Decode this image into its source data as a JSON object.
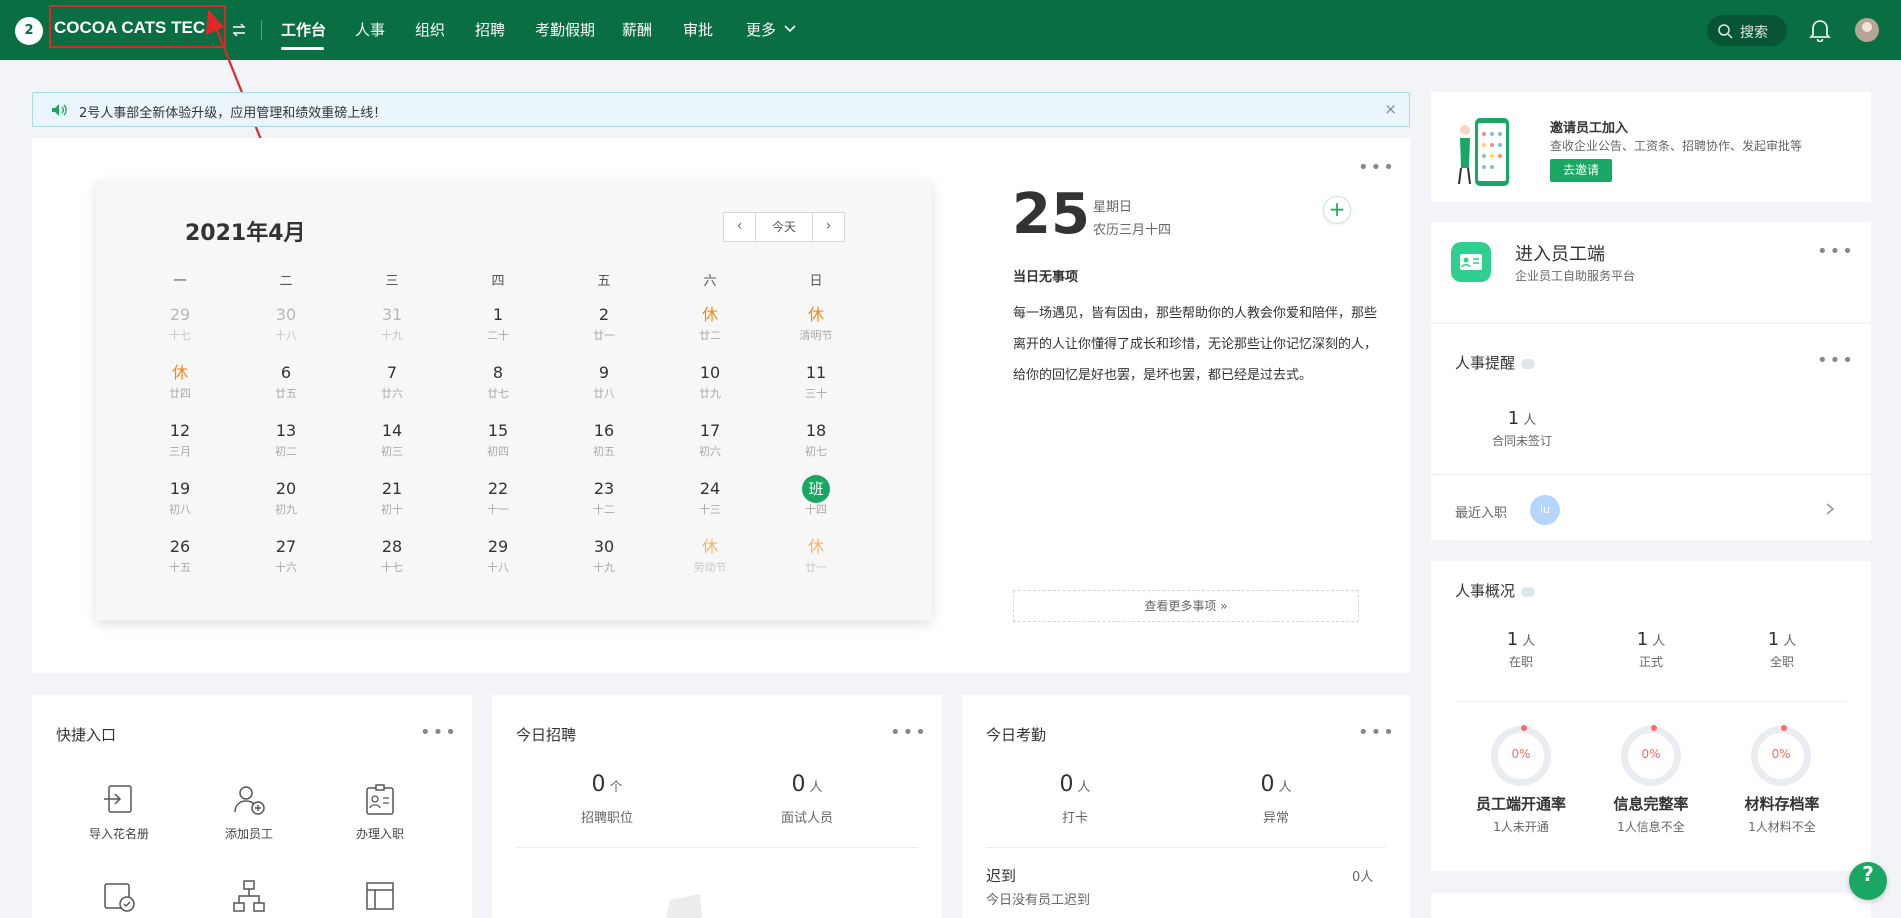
{
  "header": {
    "logo": "2",
    "company": "COCOA CATS TEC",
    "nav": [
      "工作台",
      "人事",
      "组织",
      "招聘",
      "考勤假期",
      "薪酬",
      "审批",
      "更多"
    ],
    "search_label": "搜索"
  },
  "notice": {
    "text": "2号人事部全新体验升级，应用管理和绩效重磅上线！",
    "close": "×"
  },
  "calendar": {
    "title": "2021年4月",
    "today_label": "今天",
    "prev": "‹",
    "next": "›",
    "weekdays": [
      "一",
      "二",
      "三",
      "四",
      "五",
      "六",
      "日"
    ],
    "weeks": [
      [
        {
          "n": "29",
          "s": "十七",
          "t": "other"
        },
        {
          "n": "30",
          "s": "十八",
          "t": "other"
        },
        {
          "n": "31",
          "s": "十九",
          "t": "other"
        },
        {
          "n": "1",
          "s": "二十",
          "t": ""
        },
        {
          "n": "2",
          "s": "廿一",
          "t": ""
        },
        {
          "n": "休",
          "s": "廿二",
          "t": "rest"
        },
        {
          "n": "休",
          "s": "清明节",
          "t": "rest"
        }
      ],
      [
        {
          "n": "休",
          "s": "廿四",
          "t": "rest"
        },
        {
          "n": "6",
          "s": "廿五",
          "t": ""
        },
        {
          "n": "7",
          "s": "廿六",
          "t": ""
        },
        {
          "n": "8",
          "s": "廿七",
          "t": ""
        },
        {
          "n": "9",
          "s": "廿八",
          "t": ""
        },
        {
          "n": "10",
          "s": "廿九",
          "t": ""
        },
        {
          "n": "11",
          "s": "三十",
          "t": ""
        }
      ],
      [
        {
          "n": "12",
          "s": "三月",
          "t": ""
        },
        {
          "n": "13",
          "s": "初二",
          "t": ""
        },
        {
          "n": "14",
          "s": "初三",
          "t": ""
        },
        {
          "n": "15",
          "s": "初四",
          "t": ""
        },
        {
          "n": "16",
          "s": "初五",
          "t": ""
        },
        {
          "n": "17",
          "s": "初六",
          "t": ""
        },
        {
          "n": "18",
          "s": "初七",
          "t": ""
        }
      ],
      [
        {
          "n": "19",
          "s": "初八",
          "t": ""
        },
        {
          "n": "20",
          "s": "初九",
          "t": ""
        },
        {
          "n": "21",
          "s": "初十",
          "t": ""
        },
        {
          "n": "22",
          "s": "十一",
          "t": ""
        },
        {
          "n": "23",
          "s": "十二",
          "t": ""
        },
        {
          "n": "24",
          "s": "十三",
          "t": ""
        },
        {
          "n": "班",
          "s": "十四",
          "t": "work"
        }
      ],
      [
        {
          "n": "26",
          "s": "十五",
          "t": ""
        },
        {
          "n": "27",
          "s": "十六",
          "t": ""
        },
        {
          "n": "28",
          "s": "十七",
          "t": ""
        },
        {
          "n": "29",
          "s": "十八",
          "t": ""
        },
        {
          "n": "30",
          "s": "十九",
          "t": ""
        },
        {
          "n": "休",
          "s": "劳动节",
          "t": "rest other"
        },
        {
          "n": "休",
          "s": "廿一",
          "t": "rest other"
        }
      ]
    ]
  },
  "today": {
    "day": "25",
    "weekday": "星期日",
    "lunar": "农历三月十四",
    "no_event": "当日无事项",
    "quote": "每一场遇见，皆有因由，那些帮助你的人教会你爱和陪伴，那些离开的人让你懂得了成长和珍惜，无论那些让你记忆深刻的人，给你的回忆是好也罢，是坏也罢，都已经是过去式。",
    "more": "查看更多事项 »"
  },
  "quick": {
    "title": "快捷入口",
    "items": [
      {
        "label": "导入花名册",
        "icon": "import-roster-icon"
      },
      {
        "label": "添加员工",
        "icon": "add-employee-icon"
      },
      {
        "label": "办理入职",
        "icon": "onboarding-icon"
      }
    ]
  },
  "recruit": {
    "title": "今日招聘",
    "stats": [
      {
        "num": "0",
        "unit": "个",
        "label": "招聘职位"
      },
      {
        "num": "0",
        "unit": "人",
        "label": "面试人员"
      }
    ]
  },
  "attendance": {
    "title": "今日考勤",
    "stats": [
      {
        "num": "0",
        "unit": "人",
        "label": "打卡"
      },
      {
        "num": "0",
        "unit": "人",
        "label": "异常"
      }
    ],
    "late_label": "迟到",
    "late_count": "0人",
    "late_desc": "今日没有员工迟到"
  },
  "invite": {
    "title": "邀请员工加入",
    "desc": "查收企业公告、工资条、招聘协作、发起审批等",
    "button": "去邀请"
  },
  "employee_portal": {
    "title": "进入员工端",
    "desc": "企业员工自助服务平台"
  },
  "hr_reminder": {
    "title": "人事提醒",
    "count": "1",
    "unit": "人",
    "label": "合同未签订",
    "recent_label": "最近入职",
    "recent_avatar": "iu"
  },
  "hr_overview": {
    "title": "人事概况",
    "stats": [
      {
        "num": "1",
        "unit": "人",
        "label": "在职"
      },
      {
        "num": "1",
        "unit": "人",
        "label": "正式"
      },
      {
        "num": "1",
        "unit": "人",
        "label": "全职"
      }
    ],
    "rates": [
      {
        "value": "0%",
        "title": "员工端开通率",
        "sub": "1人未开通"
      },
      {
        "value": "0%",
        "title": "信息完整率",
        "sub": "1人信息不全"
      },
      {
        "value": "0%",
        "title": "材料存档率",
        "sub": "1人材料不全"
      }
    ]
  },
  "help": "?"
}
